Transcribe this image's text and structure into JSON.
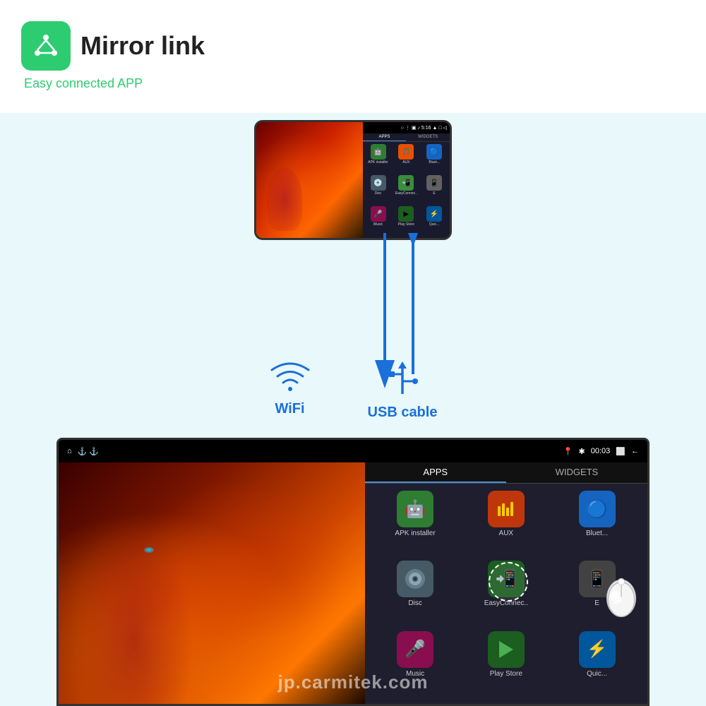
{
  "header": {
    "title": "Mirror link",
    "subtitle": "Easy connected APP",
    "icon_label": "mirror-link-icon"
  },
  "phone": {
    "status_time": "5:16",
    "tabs": [
      "APPS",
      "WIDGETS"
    ],
    "apps": [
      {
        "label": "APK installer",
        "color": "#4caf50",
        "icon": "🤖"
      },
      {
        "label": "AUX",
        "color": "#ff9800",
        "icon": "🎵"
      },
      {
        "label": "Bluet...",
        "color": "#2196f3",
        "icon": "🔵"
      },
      {
        "label": "Disc",
        "color": "#607d8b",
        "icon": "💿"
      },
      {
        "label": "EasyConnec..",
        "color": "#4caf50",
        "icon": "📲"
      },
      {
        "label": "E",
        "color": "#9e9e9e",
        "icon": "📱"
      },
      {
        "label": "Music",
        "color": "#e91e63",
        "icon": "🎤"
      },
      {
        "label": "Play Store",
        "color": "#4caf50",
        "icon": "▶️"
      },
      {
        "label": "Quic...",
        "color": "#03a9f4",
        "icon": "⚡"
      }
    ]
  },
  "connection": {
    "wifi_label": "WiFi",
    "usb_label": "USB cable"
  },
  "car_unit": {
    "status_time": "00:03",
    "tabs": [
      "APPS",
      "WIDGETS"
    ],
    "apps": [
      {
        "label": "APK installer",
        "color": "#4caf50",
        "icon": "🤖"
      },
      {
        "label": "AUX",
        "color": "#ff9800",
        "icon": "🎵"
      },
      {
        "label": "Bluet...",
        "color": "#2196f3",
        "icon": "🔵"
      },
      {
        "label": "Disc",
        "color": "#607d8b",
        "icon": "💿"
      },
      {
        "label": "EasyConnec..",
        "color": "#4caf50",
        "icon": "📲"
      },
      {
        "label": "E",
        "color": "#9e9e9e",
        "icon": "📱"
      },
      {
        "label": "Music",
        "color": "#e91e63",
        "icon": "🎤"
      },
      {
        "label": "Play Store",
        "color": "#4caf50",
        "icon": "▶️"
      },
      {
        "label": "Quic...",
        "color": "#03a9f4",
        "icon": "⚡"
      }
    ]
  },
  "watermark": "jp.carmitek.com"
}
